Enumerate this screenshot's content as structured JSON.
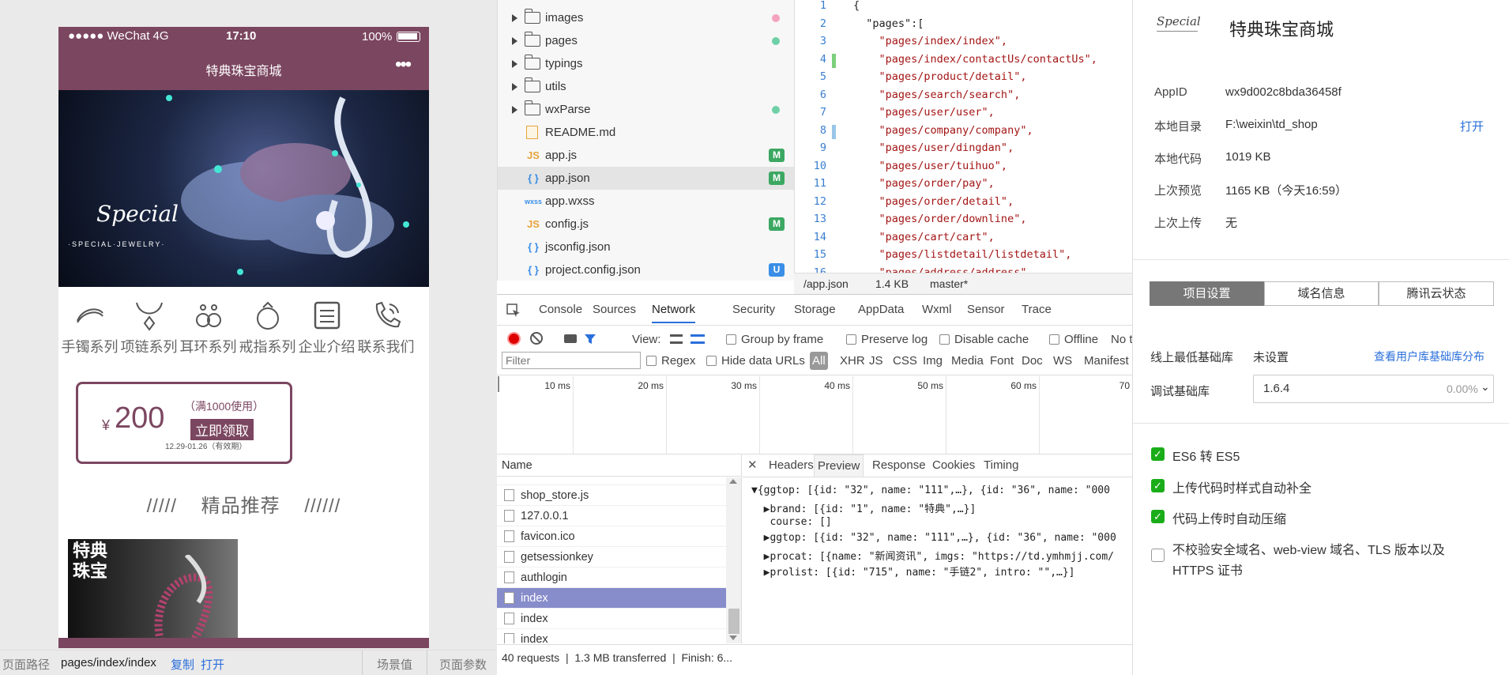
{
  "simulator": {
    "status": {
      "signal": "●●●●● WeChat 4G",
      "time": "17:10",
      "battery": "100%"
    },
    "nav_title": "特典珠宝商城",
    "nav_more": "•••",
    "banner_brand": "Special",
    "banner_sub": "·SPECIAL·JEWELRY·",
    "categories": [
      {
        "label": "手镯系列",
        "icon": "bracelet-icon"
      },
      {
        "label": "项链系列",
        "icon": "necklace-icon"
      },
      {
        "label": "耳环系列",
        "icon": "earring-icon"
      },
      {
        "label": "戒指系列",
        "icon": "ring-icon"
      },
      {
        "label": "企业介绍",
        "icon": "document-icon"
      },
      {
        "label": "联系我们",
        "icon": "phone-icon"
      }
    ],
    "coupon": {
      "currency": "¥",
      "amount": "200",
      "condition": "（满1000使用）",
      "button": "立即领取",
      "validity": "12.29-01.26（有效期）"
    },
    "recommend_title": "/////    精品推荐    //////",
    "product_text": "特典\n珠宝"
  },
  "sim_footer": {
    "path_label": "页面路径",
    "path": "pages/index/index",
    "copy": "复制",
    "open": "打开",
    "scene": "场景值",
    "params": "页面参数"
  },
  "file_tree": [
    {
      "name": "images",
      "type": "folder",
      "status": "dot",
      "color": "#f4a3bd"
    },
    {
      "name": "pages",
      "type": "folder",
      "status": "dot",
      "color": "#6fd0a7"
    },
    {
      "name": "typings",
      "type": "folder",
      "status": "",
      "color": ""
    },
    {
      "name": "utils",
      "type": "folder",
      "status": "",
      "color": ""
    },
    {
      "name": "wxParse",
      "type": "folder",
      "status": "dot",
      "color": "#6fd0a7"
    },
    {
      "name": "README.md",
      "type": "md",
      "status": "",
      "color": ""
    },
    {
      "name": "app.js",
      "type": "js",
      "status": "M",
      "color": "#3ca862"
    },
    {
      "name": "app.json",
      "type": "json",
      "status": "M",
      "color": "#3ca862"
    },
    {
      "name": "app.wxss",
      "type": "wxss",
      "status": "",
      "color": ""
    },
    {
      "name": "config.js",
      "type": "js",
      "status": "M",
      "color": "#3ca862"
    },
    {
      "name": "jsconfig.json",
      "type": "json",
      "status": "",
      "color": ""
    },
    {
      "name": "project.config.json",
      "type": "json",
      "status": "U",
      "color": "#3a8ee6"
    }
  ],
  "editor": {
    "lines": [
      {
        "n": "1",
        "t": "{"
      },
      {
        "n": "2",
        "t": "  \"pages\":["
      },
      {
        "n": "3",
        "t": "    \"pages/index/index\","
      },
      {
        "n": "4",
        "t": "    \"pages/index/contactUs/contactUs\","
      },
      {
        "n": "5",
        "t": "    \"pages/product/detail\","
      },
      {
        "n": "6",
        "t": "    \"pages/search/search\","
      },
      {
        "n": "7",
        "t": "    \"pages/user/user\","
      },
      {
        "n": "8",
        "t": "    \"pages/company/company\","
      },
      {
        "n": "9",
        "t": "    \"pages/user/dingdan\","
      },
      {
        "n": "10",
        "t": "    \"pages/user/tuihuo\","
      },
      {
        "n": "11",
        "t": "    \"pages/order/pay\","
      },
      {
        "n": "12",
        "t": "    \"pages/order/detail\","
      },
      {
        "n": "13",
        "t": "    \"pages/order/downline\","
      },
      {
        "n": "14",
        "t": "    \"pages/cart/cart\","
      },
      {
        "n": "15",
        "t": "    \"pages/listdetail/listdetail\","
      },
      {
        "n": "16",
        "t": "    \"pages/address/address\","
      }
    ],
    "status": {
      "file": "/app.json",
      "size": "1.4 KB",
      "branch": "master*"
    }
  },
  "devtools": {
    "tabs": [
      "Console",
      "Sources",
      "Network",
      "Security",
      "Storage",
      "AppData",
      "Wxml",
      "Sensor",
      "Trace"
    ],
    "active_tab": "Network",
    "toolbar": {
      "view": "View:",
      "group": "Group by frame",
      "preserve": "Preserve log",
      "disable_cache": "Disable cache",
      "offline": "Offline",
      "throttle": "No t"
    },
    "filter": {
      "placeholder": "Filter",
      "regex": "Regex",
      "hide_data": "Hide data URLs",
      "types": [
        "All",
        "XHR",
        "JS",
        "CSS",
        "Img",
        "Media",
        "Font",
        "Doc",
        "WS",
        "Manifest"
      ]
    },
    "timeline": [
      "10 ms",
      "20 ms",
      "30 ms",
      "40 ms",
      "50 ms",
      "60 ms",
      "70"
    ],
    "name_header": "Name",
    "requests": [
      "shop_store.js",
      "127.0.0.1",
      "favicon.ico",
      "getsessionkey",
      "authlogin",
      "index",
      "index",
      "index"
    ],
    "selected_request": "index",
    "detail_tabs": [
      "Headers",
      "Preview",
      "Response",
      "Cookies",
      "Timing"
    ],
    "active_detail": "Preview",
    "preview": [
      "▼{ggtop: [{id: \"32\", name: \"111\",…}, {id: \"36\", name: \"000",
      "  ▶brand: [{id: \"1\", name: \"特典\",…}]",
      "   course: []",
      "  ▶ggtop: [{id: \"32\", name: \"111\",…}, {id: \"36\", name: \"000",
      "  ▶procat: [{name: \"新闻资讯\", imgs: \"https://td.ymhmjj.com/",
      "  ▶prolist: [{id: \"715\", name: \"手链2\", intro: \"\",…}]"
    ],
    "summary": "40 requests  |  1.3 MB transferred  |  Finish: 6..."
  },
  "project": {
    "name": "特典珠宝商城",
    "logo": "Special",
    "appid_label": "AppID",
    "appid": "wx9d002c8bda36458f",
    "dir_label": "本地目录",
    "dir": "F:\\weixin\\td_shop",
    "open": "打开",
    "code_label": "本地代码",
    "code": "1019 KB",
    "preview_label": "上次预览",
    "preview": "1165 KB（今天16:59）",
    "upload_label": "上次上传",
    "upload": "无",
    "tabs": [
      "项目设置",
      "域名信息",
      "腾讯云状态"
    ],
    "lib_min_label": "线上最低基础库",
    "lib_min": "未设置",
    "lib_link": "查看用户库基础库分布",
    "lib_debug_label": "调试基础库",
    "lib_debug": "1.6.4",
    "lib_pct": "0.00%",
    "options": [
      {
        "label": "ES6 转 ES5",
        "checked": true
      },
      {
        "label": "上传代码时样式自动补全",
        "checked": true
      },
      {
        "label": "代码上传时自动压缩",
        "checked": true
      },
      {
        "label": "不校验安全域名、web-view 域名、TLS 版本以及",
        "label2": "HTTPS 证书",
        "checked": false
      }
    ]
  }
}
